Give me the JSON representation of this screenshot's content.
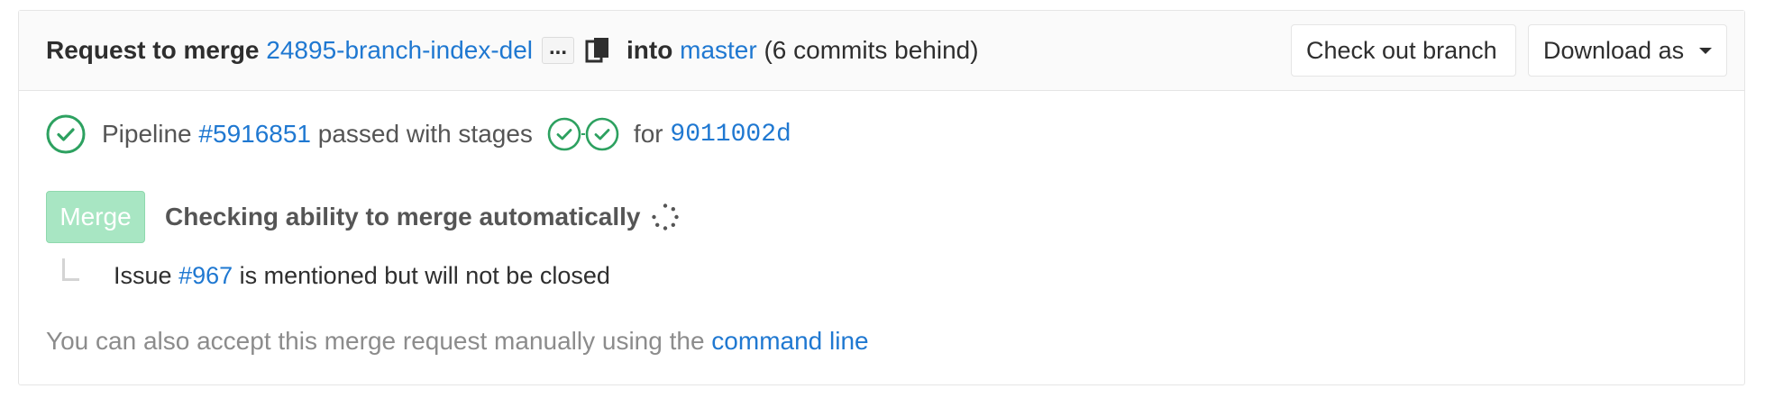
{
  "header": {
    "title_prefix": "Request to merge",
    "source_branch": "24895-branch-index-del",
    "ellipsis": "...",
    "into_label": "into",
    "target_branch": "master",
    "behind_text": "(6 commits behind)",
    "checkout_label": "Check out branch",
    "download_label": "Download as"
  },
  "pipeline": {
    "label": "Pipeline",
    "id": "#5916851",
    "status_text": "passed with stages",
    "for_label": "for",
    "commit": "9011002d",
    "status_color": "#2da160"
  },
  "merge": {
    "button_label": "Merge",
    "status_text": "Checking ability to merge automatically"
  },
  "issue": {
    "prefix": "Issue",
    "id": "#967",
    "suffix": "is mentioned but will not be closed"
  },
  "manual": {
    "text": "You can also accept this merge request manually using the",
    "link": "command line"
  },
  "colors": {
    "link": "#1f78d1",
    "success": "#2da160",
    "merge_disabled": "#a8e6c3"
  }
}
